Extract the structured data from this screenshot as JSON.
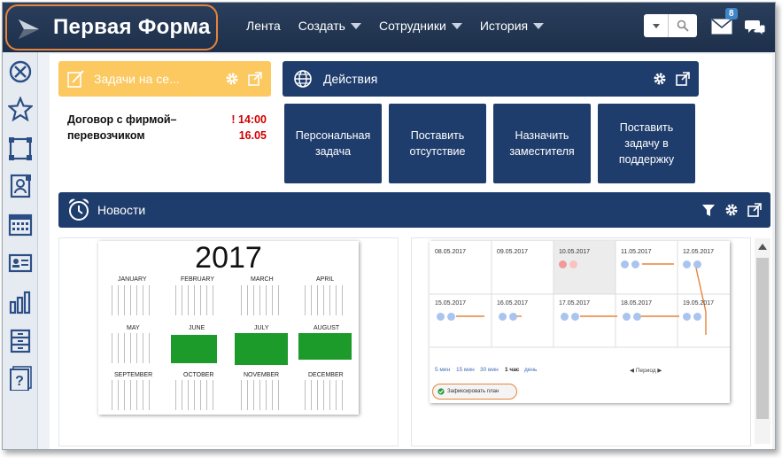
{
  "app": {
    "title": "Первая Форма"
  },
  "nav": {
    "feed": "Лента",
    "create": "Создать",
    "staff": "Сотрудники",
    "history": "История"
  },
  "mail": {
    "badge": "8"
  },
  "tasks": {
    "title": "Задачи на се...",
    "items": [
      {
        "line1": "Договор с фирмой–",
        "time": "! 14:00",
        "line2": "перевозчиком",
        "date": "16.05"
      }
    ]
  },
  "actions": {
    "title": "Действия",
    "buttons": [
      {
        "label": "Персональная задача"
      },
      {
        "label": "Поставить отсутствие"
      },
      {
        "label": "Назначить заместителя"
      },
      {
        "label": "Поставить задачу в поддержку"
      }
    ]
  },
  "news": {
    "title": "Новости",
    "calendar": {
      "year": "2017",
      "months": [
        "JANUARY",
        "FEBRUARY",
        "MARCH",
        "APRIL",
        "MAY",
        "JUNE",
        "JULY",
        "AUGUST",
        "SEPTEMBER",
        "OCTOBER",
        "NOVEMBER",
        "DECEMBER"
      ]
    },
    "plan": {
      "dates_row1": [
        "08.05.2017",
        "09.05.2017",
        "10.05.2017",
        "11.05.2017",
        "12.05.2017"
      ],
      "dates_row2": [
        "15.05.2017",
        "16.05.2017",
        "17.05.2017",
        "18.05.2017",
        "19.05.2017"
      ],
      "scales": [
        "5 мин",
        "15 мин",
        "30 мин",
        "1 час",
        "день"
      ],
      "period": "Период",
      "fix_button": "Зафиксировать план"
    }
  },
  "colors": {
    "brand_dark": "#1f3d6c",
    "tasks_yellow": "#fcc860",
    "highlight_orange": "#e8833a",
    "deadline_red": "#d10000"
  },
  "icons": [
    "logo-icon",
    "search-icon",
    "mail-icon",
    "chat-icon",
    "gear-icon",
    "external-link-icon",
    "filter-icon",
    "alarm-clock-icon",
    "globe-icon",
    "pencil-icon",
    "compass-icon",
    "star-icon",
    "diagram-icon",
    "contact-book-icon",
    "calendar-icon",
    "id-card-icon",
    "bar-chart-icon",
    "archive-icon",
    "help-icon"
  ]
}
